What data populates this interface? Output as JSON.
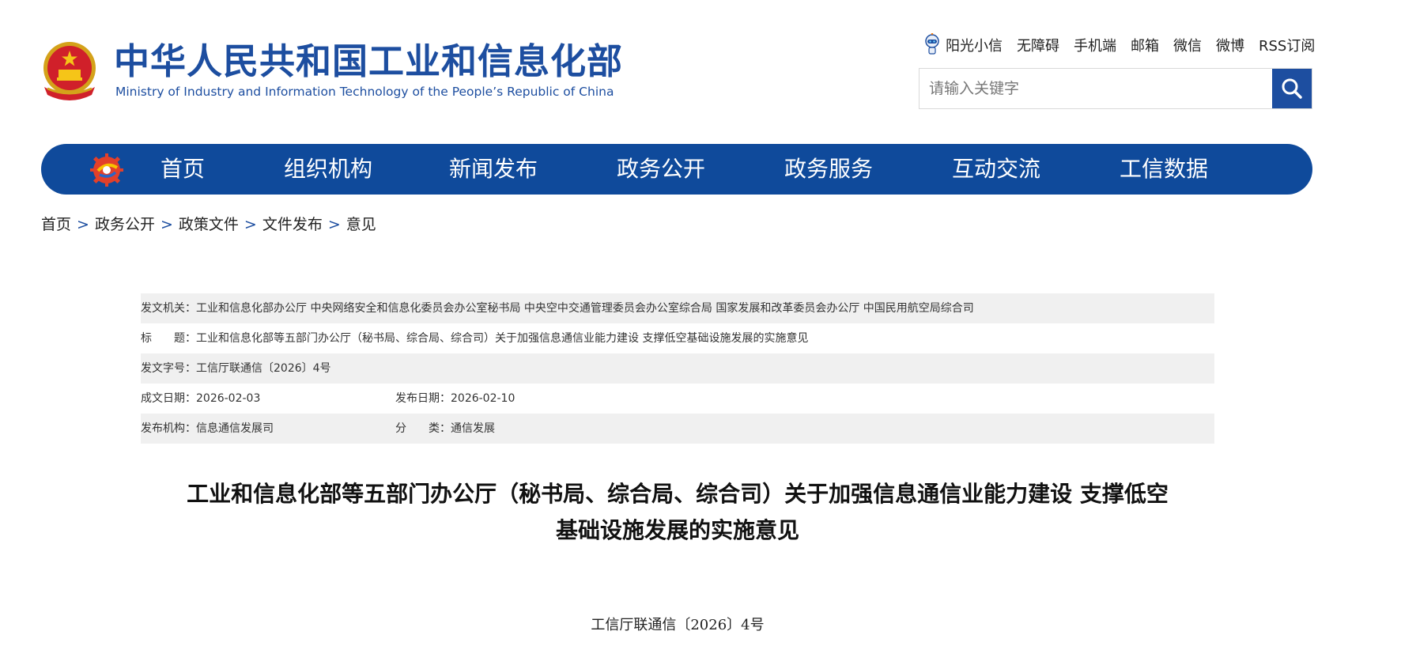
{
  "header": {
    "ministry_name_cn": "中华人民共和国工业和信息化部",
    "ministry_name_en": "Ministry of Industry and Information Technology of the People’s Republic of China",
    "emblem_icon": "national-emblem-icon",
    "top_links": [
      "阳光小信",
      "无障碍",
      "手机端",
      "邮箱",
      "微信",
      "微博",
      "RSS订阅"
    ],
    "search": {
      "placeholder": "请输入关键字",
      "icon": "search-icon"
    }
  },
  "nav": {
    "logo_icon": "miit-gear-logo-icon",
    "items": [
      "首页",
      "组织机构",
      "新闻发布",
      "政务公开",
      "政务服务",
      "互动交流",
      "工信数据"
    ]
  },
  "breadcrumb": {
    "items": [
      "首页",
      "政务公开",
      "政策文件",
      "文件发布",
      "意见"
    ],
    "separator": ">"
  },
  "info": {
    "issuer_label": "发文机关：",
    "issuer_value": "工业和信息化部办公厅 中央网络安全和信息化委员会办公室秘书局 中央空中交通管理委员会办公室综合局 国家发展和改革委员会办公厅 中国民用航空局综合司",
    "title_label": "标　　题：",
    "title_value": "工业和信息化部等五部门办公厅（秘书局、综合局、综合司）关于加强信息通信业能力建设 支撑低空基础设施发展的实施意见",
    "doc_no_label": "发文字号：",
    "doc_no_value": "工信厅联通信〔2026〕4号",
    "created_label": "成文日期：",
    "created_value": "2026-02-03",
    "published_label": "发布日期：",
    "published_value": "2026-02-10",
    "org_label": "发布机构：",
    "org_value": "信息通信发展司",
    "category_label": "分　　类：",
    "category_value": "通信发展"
  },
  "article": {
    "title_line1": "工业和信息化部等五部门办公厅（秘书局、综合局、综合司）关于加强信息通信业能力建设 支撑低空",
    "title_line2": "基础设施发展的实施意见",
    "doc_number": "工信厅联通信〔2026〕4号"
  },
  "colors": {
    "brand_blue": "#1d4ea0",
    "nav_blue": "#0f4a9b",
    "row_shade": "#f0f0f0"
  }
}
